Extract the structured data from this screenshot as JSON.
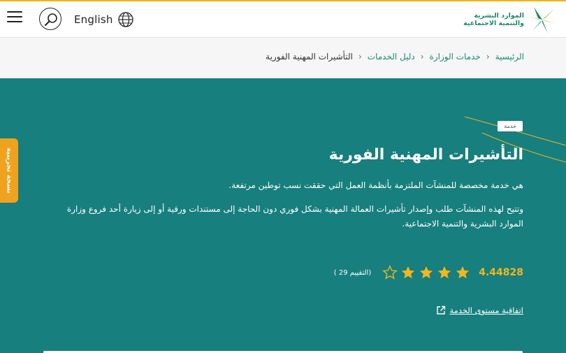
{
  "header": {
    "language_label": "English",
    "logo_line1": "الموارد البشرية",
    "logo_line2": "والتنمية الاجتماعية"
  },
  "breadcrumb": {
    "items": [
      "الرئيسية",
      "خدمات الوزارة",
      "دليل الخدمات"
    ],
    "current": "التأشيرات المهنية الفورية"
  },
  "hero": {
    "tag": "خدمة",
    "title": "التأشيرات المهنية الفورية",
    "description1": "هي خدمة مخصصة للمنشآت الملتزمة بأنظمة العمل التي حققت نسب توطين مرتفعة.",
    "description2": "وتتيح لهذه المنشآت طلب وإصدار تأشيرات العمالة المهنية بشكل فوري دون الحاجة إلى مستندات ورقية أو إلى زيارة أحد فروع وزارة الموارد البشرية والتنمية الاجتماعية."
  },
  "rating": {
    "value": "4.44828",
    "stars_filled": 4,
    "stars_total": 5,
    "count_label": "(التقييم 29 )"
  },
  "sla_link": "اتفاقية مستوى الخدمة",
  "beta_label": "نسخة تجريبية",
  "colors": {
    "accent": "#f0b51e",
    "hero_bg": "#177f7d",
    "link_green": "#1a8a73",
    "star": "#f3b61f"
  }
}
